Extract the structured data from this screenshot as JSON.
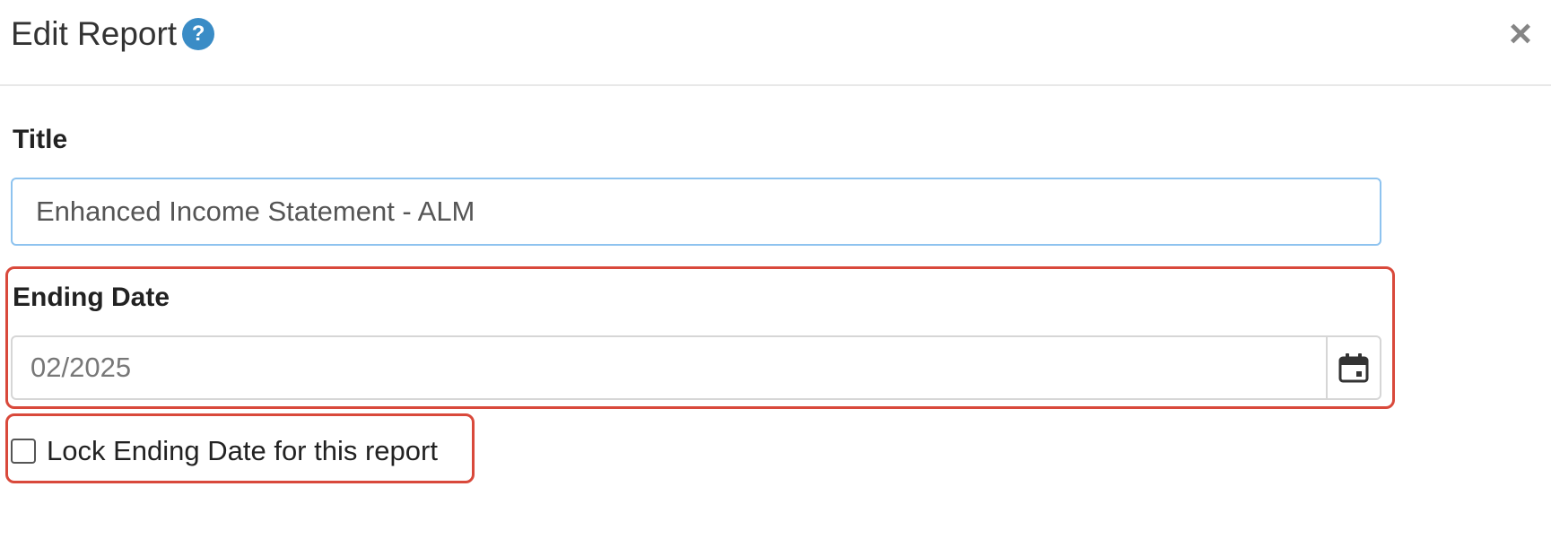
{
  "header": {
    "title": "Edit Report",
    "help_icon": "help-icon",
    "help_glyph": "?",
    "close_icon": "close-icon",
    "close_glyph": "×"
  },
  "form": {
    "title_label": "Title",
    "title_value": "Enhanced Income Statement - ALM",
    "ending_date_label": "Ending Date",
    "ending_date_value": "02/2025",
    "calendar_icon": "calendar-icon",
    "lock_checkbox_checked": false,
    "lock_label": "Lock Ending Date for this report"
  },
  "colors": {
    "help_icon_bg": "#3a8cc6",
    "highlight_border": "#d9493b",
    "title_input_border": "#8ec3ef"
  }
}
